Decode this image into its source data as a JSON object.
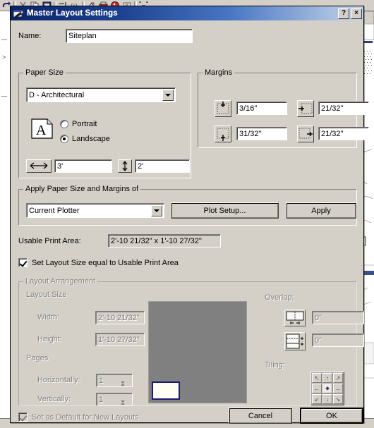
{
  "background_app": {
    "toolbar_icons": [
      "undo-icon",
      "separator",
      "cut-icon",
      "copy-icon",
      "paste-icon",
      "separator",
      "align-icon",
      "rotate-icon",
      "separator",
      "measure-icon",
      "printer-icon",
      "palette-icon",
      "speaker-icon",
      "separator",
      "zoom-extents-icon"
    ]
  },
  "dialog": {
    "title": "Master Layout Settings",
    "title_icon": "layout-settings-icon",
    "help_button": "?",
    "close_button": "×",
    "name": {
      "label": "Name:",
      "value": "Siteplan"
    },
    "paper_size": {
      "legend": "Paper Size",
      "preset": "D - Architectural",
      "orientation_icon": "page-orientation-icon",
      "orientation_selected": "Landscape",
      "options": [
        {
          "label": "Portrait",
          "selected": false
        },
        {
          "label": "Landscape",
          "selected": true
        }
      ],
      "width": {
        "icon": "horizontal-arrow-icon",
        "value": "3'"
      },
      "height": {
        "icon": "vertical-arrow-icon",
        "value": "2'"
      }
    },
    "margins": {
      "legend": "Margins",
      "fields": [
        {
          "icon": "margin-top-icon",
          "value": "3/16\""
        },
        {
          "icon": "margin-left-icon",
          "value": "21/32\""
        },
        {
          "icon": "margin-bottom-icon",
          "value": "31/32\""
        },
        {
          "icon": "margin-right-icon",
          "value": "21/32\""
        }
      ]
    },
    "apply_group": {
      "legend": "Apply Paper Size and Margins of",
      "source": "Current Plotter",
      "plot_setup_button": "Plot Setup...",
      "apply_button": "Apply"
    },
    "usable_print_area": {
      "label": "Usable Print Area:",
      "value": "2'-10 21/32\" x 1'-10 27/32\""
    },
    "set_layout_size_checkbox": {
      "label": "Set Layout Size equal to Usable Print Area",
      "checked": true,
      "enabled": true
    },
    "layout_arrangement": {
      "legend": "Layout Arrangement",
      "enabled": false,
      "layout_size_label": "Layout Size",
      "width": {
        "label": "Width:",
        "value": "2'-10 21/32\""
      },
      "height": {
        "label": "Height:",
        "value": "1'-10 27/32\""
      },
      "pages_label": "Pages",
      "horizontally": {
        "label": "Horizontally:",
        "value": "1"
      },
      "vertically": {
        "label": "Vertically:",
        "value": "1"
      },
      "overlap": {
        "label": "Overlap:",
        "horizontal": {
          "icon": "overlap-horizontal-icon",
          "value": "0\""
        },
        "vertical": {
          "icon": "overlap-vertical-icon",
          "value": "0\""
        }
      },
      "tiling": {
        "label": "Tiling:",
        "icon": "tiling-anchor-grid-icon",
        "cells": [
          "↖",
          "↑",
          "↗",
          "←",
          "⬥",
          "→",
          "↙",
          "↓",
          "↘"
        ],
        "selected_index": 4
      },
      "preview": {
        "sheet_color": "#808080",
        "page_color": "#fffff4",
        "page_border_color": "#1a1a7a"
      }
    },
    "set_as_default_checkbox": {
      "label": "Set as Default for New Layouts",
      "checked": true,
      "enabled": false
    },
    "cancel_button": "Cancel",
    "ok_button": "OK"
  },
  "colors": {
    "dialog_face": "#d4d0c8",
    "title_gradient_start": "#0a246a",
    "title_gradient_end": "#c3d2e8",
    "disabled_text": "#808080"
  }
}
